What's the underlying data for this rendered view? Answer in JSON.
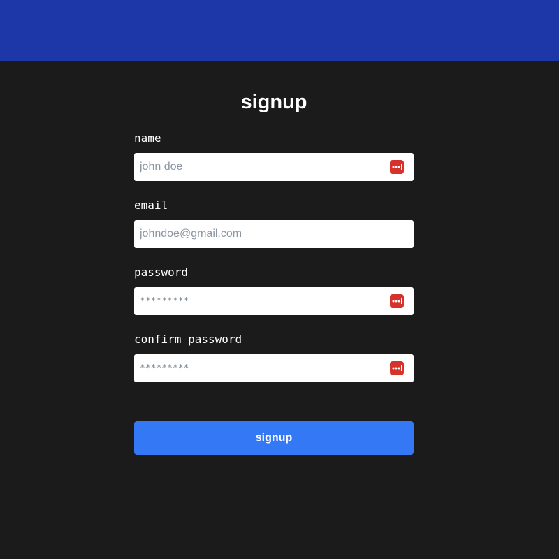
{
  "header": {
    "color": "#1e37a8"
  },
  "form": {
    "title": "signup",
    "fields": [
      {
        "label": "name",
        "placeholder": "john doe",
        "has_password_manager_icon": true
      },
      {
        "label": "email",
        "placeholder": "johndoe@gmail.com",
        "has_password_manager_icon": false
      },
      {
        "label": "password",
        "placeholder": "*********",
        "has_password_manager_icon": true
      },
      {
        "label": "confirm password",
        "placeholder": "*********",
        "has_password_manager_icon": true
      }
    ],
    "submit_label": "signup"
  },
  "colors": {
    "background": "#1b1b1b",
    "accent": "#3478f6",
    "password_manager_icon": "#d6322c"
  },
  "icons": {
    "password_manager": "password-manager-icon"
  }
}
